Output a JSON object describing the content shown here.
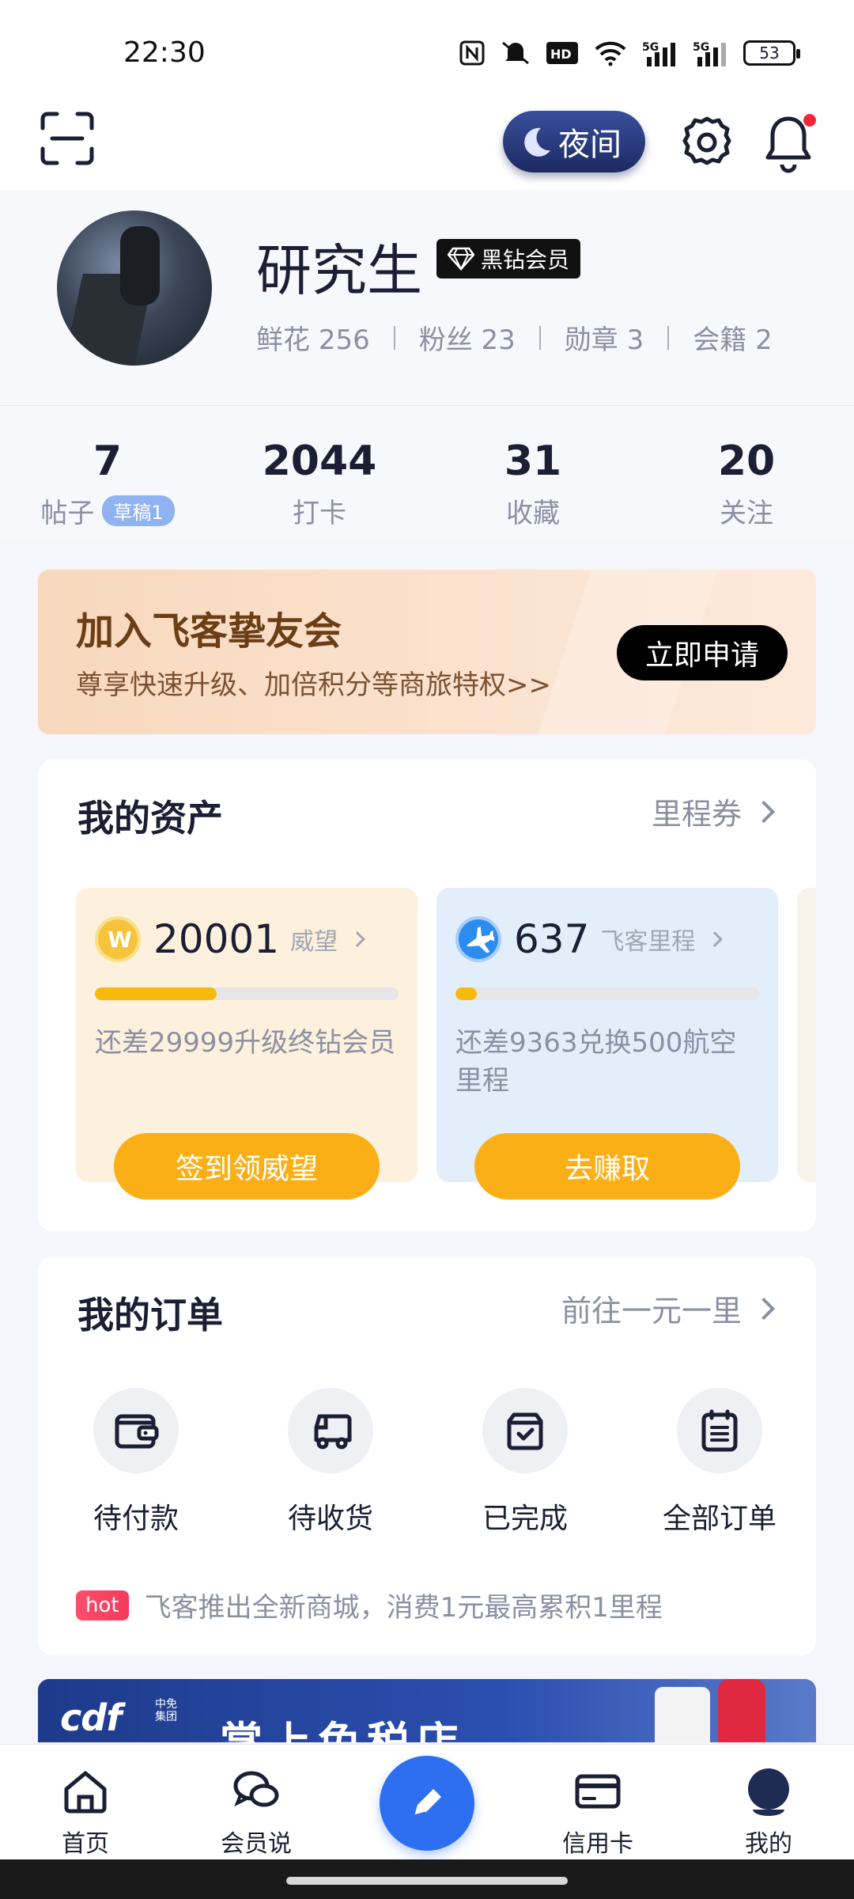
{
  "status_bar": {
    "time": "22:30",
    "icons": [
      "nfc-icon",
      "mute-icon",
      "hd-icon",
      "wifi-icon",
      "signal-5g-icon",
      "signal-5g-icon"
    ],
    "network_label": "5G",
    "battery": "53"
  },
  "header": {
    "night_label": "夜间",
    "has_notification": true
  },
  "profile": {
    "username": "研究生",
    "vip_label": "黑钻会员",
    "stats": [
      {
        "label": "鲜花",
        "value": "256"
      },
      {
        "label": "粉丝",
        "value": "23"
      },
      {
        "label": "勋章",
        "value": "3"
      },
      {
        "label": "会籍",
        "value": "2"
      }
    ]
  },
  "counts": [
    {
      "value": "7",
      "label": "帖子",
      "badge": "草稿1"
    },
    {
      "value": "2044",
      "label": "打卡"
    },
    {
      "value": "31",
      "label": "收藏"
    },
    {
      "value": "20",
      "label": "关注"
    }
  ],
  "join_banner": {
    "title": "加入飞客挚友会",
    "subtitle": "尊享快速升级、加倍积分等商旅特权>>",
    "button": "立即申请"
  },
  "assets": {
    "title": "我的资产",
    "link": "里程券",
    "items": [
      {
        "value": "20001",
        "unit": "威望",
        "progress": 0.4,
        "desc": "还差29999升级终钻会员",
        "button": "签到领威望",
        "icon": "coin-w-icon",
        "bg": "#fdf0dd"
      },
      {
        "value": "637",
        "unit": "飞客里程",
        "progress": 0.07,
        "desc": "还差9363兑换500航空里程",
        "button": "去赚取",
        "icon": "plane-icon",
        "bg": "#e3eefb"
      }
    ]
  },
  "orders": {
    "title": "我的订单",
    "link": "前往一元一里",
    "items": [
      {
        "label": "待付款",
        "icon": "wallet-icon"
      },
      {
        "label": "待收货",
        "icon": "truck-icon"
      },
      {
        "label": "已完成",
        "icon": "box-check-icon"
      },
      {
        "label": "全部订单",
        "icon": "clipboard-list-icon"
      }
    ],
    "hot_tag": "hot",
    "hot_text": "飞客推出全新商城，消费1元最高累积1里程"
  },
  "promo_banner": {
    "logo": "cdf",
    "logo_sub": "中免集团",
    "title": "掌上免税店"
  },
  "tabbar": [
    {
      "label": "首页",
      "icon": "home-icon"
    },
    {
      "label": "会员说",
      "icon": "chat-bubbles-icon"
    },
    {
      "label": "",
      "icon": "compose-pencil-icon"
    },
    {
      "label": "信用卡",
      "icon": "credit-card-icon"
    },
    {
      "label": "我的",
      "icon": "profile-icon"
    }
  ]
}
